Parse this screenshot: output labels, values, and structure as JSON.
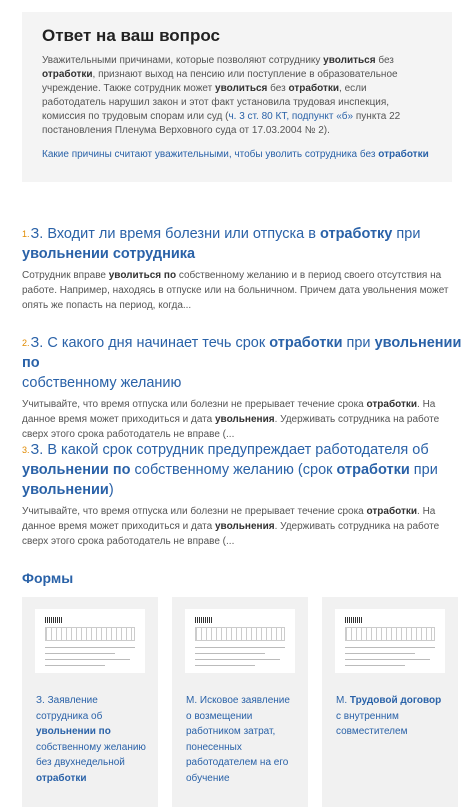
{
  "answer": {
    "title": "Ответ на ваш вопрос",
    "t1": "Уважительными причинами, которые позволяют сотруднику ",
    "b1": "уволиться",
    "t2": " без ",
    "b2": "отработки",
    "t3": ", признают выход на пенсию или поступление в образовательное учреждение. Также сотрудник может ",
    "b3": "уволиться",
    "t4": " без ",
    "b4": "отработки",
    "t5": ", если работодатель нарушил закон и этот факт установила трудовая инспекция, комиссия по трудовым спорам или суд (",
    "ref": "ч. 3 ст. 80 КТ, подпункт «б»",
    "t6": " пункта 22 постановления Пленума Верховного суда от 17.03.2004 № 2).",
    "link_text": "Какие причины считают уважительными, чтобы уволить сотрудника без ",
    "link_bold": "отработки"
  },
  "questions": [
    {
      "num": "1.",
      "t1": "З. Входит ли время болезни или отпуска в ",
      "b1": "отработку",
      "t2": " при ",
      "b2": "увольнении сотрудника",
      "s1": "Сотрудник вправе ",
      "sb1": "уволиться по",
      "s2": " собственному желанию и в период своего отсутствия на работе. Например, находясь в отпуске или на больничном. Причем дата увольнения может опять же попасть на период, когда..."
    },
    {
      "num": "2.",
      "t1": "З. С какого дня начинает течь срок ",
      "b1": "отработки",
      "t2": " при ",
      "b2": "увольнении по",
      "t3": " собственному желанию",
      "s1": "Учитывайте, что время отпуска или болезни не прерывает течение срока ",
      "sb1": "отработки",
      "s2": ". На данное время может приходиться и дата ",
      "sb2": "увольнения",
      "s3": ". Удерживать сотрудника на работе сверх этого срока работодатель не вправе (..."
    },
    {
      "num": "3.",
      "t1": "З. В какой срок сотрудник предупреждает работодателя об ",
      "b1": "увольнении по",
      "t2": " собственному желанию (срок ",
      "b2": "отработки",
      "t3": " при ",
      "b3": "увольнении",
      "t4": ")",
      "s1": "Учитывайте, что время отпуска или болезни не прерывает течение срока ",
      "sb1": "отработки",
      "s2": ". На данное время может приходиться и дата ",
      "sb2": "увольнения",
      "s3": ". Удерживать сотрудника на работе сверх этого срока работодатель не вправе (..."
    }
  ],
  "forms": {
    "heading": "Формы",
    "cards": [
      {
        "p1": "З. Заявление сотрудника об ",
        "b1": "увольнении по",
        "p2": " собственному желанию без двухнедельной ",
        "b2": "отработки",
        "p3": ""
      },
      {
        "p1": "М. Исковое заявление о возмещении работником затрат, понесенных работодателем на его обучение",
        "b1": "",
        "p2": "",
        "b2": "",
        "p3": ""
      },
      {
        "p1": "М. ",
        "b1": "Трудовой договор",
        "p2": " с внутренним совместителем",
        "b2": "",
        "p3": ""
      }
    ]
  }
}
